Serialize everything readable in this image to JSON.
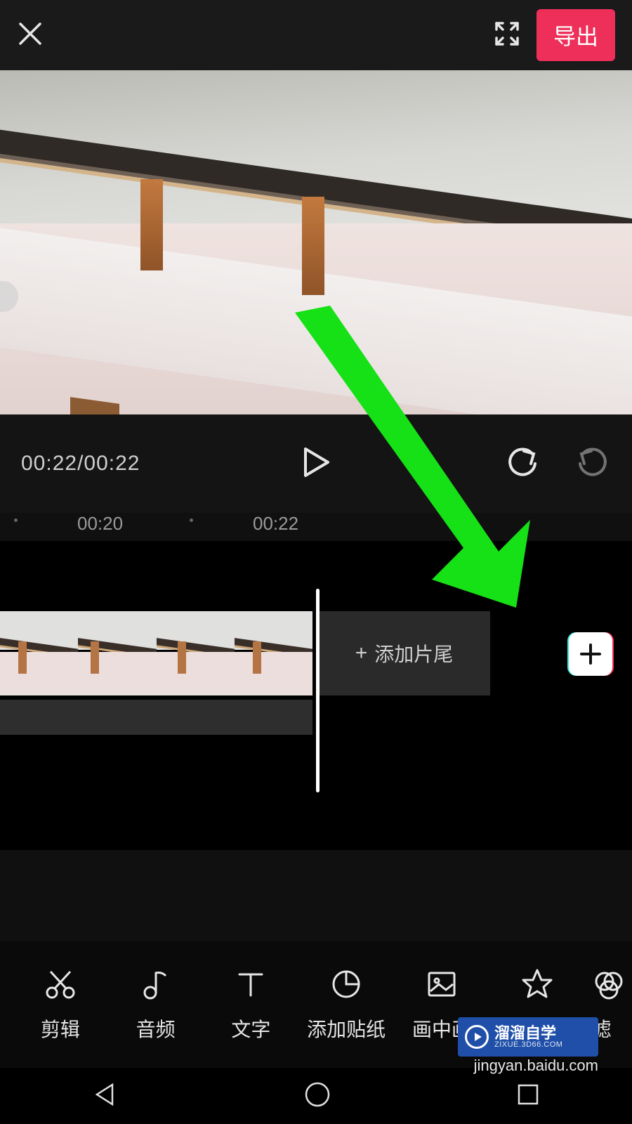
{
  "topbar": {
    "export_label": "导出"
  },
  "playback": {
    "time": "00:22/00:22"
  },
  "ruler": {
    "t1": "00:20",
    "t2": "00:22"
  },
  "timeline": {
    "add_ending_label": "添加片尾"
  },
  "tools": {
    "items": [
      {
        "label": "剪辑"
      },
      {
        "label": "音频"
      },
      {
        "label": "文字"
      },
      {
        "label": "添加贴纸"
      },
      {
        "label": "画中画"
      },
      {
        "label": "特效"
      },
      {
        "label": "滤"
      }
    ]
  },
  "watermark": {
    "brand": "溜溜自学",
    "sub": "ZIXUE.3D66.COM",
    "url": "jingyan.baidu.com"
  },
  "annotation": {
    "arrow_color": "#18d818"
  }
}
